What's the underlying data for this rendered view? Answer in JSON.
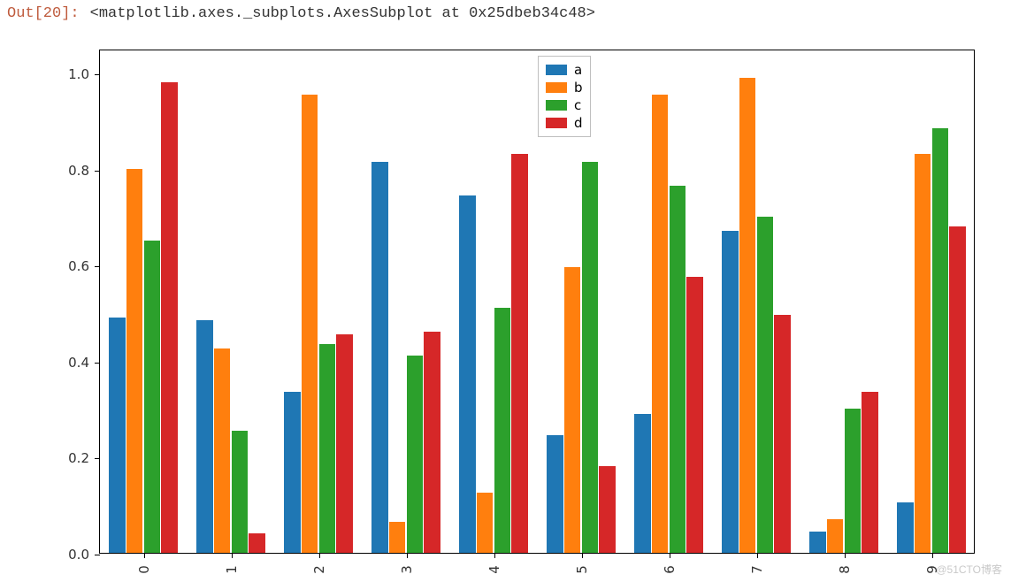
{
  "output_prompt": "Out[20]:",
  "output_repr": "<matplotlib.axes._subplots.AxesSubplot at 0x25dbeb34c48>",
  "watermark": "@51CTO博客",
  "chart_data": {
    "type": "bar",
    "title": "",
    "xlabel": "",
    "ylabel": "",
    "categories": [
      "0",
      "1",
      "2",
      "3",
      "4",
      "5",
      "6",
      "7",
      "8",
      "9"
    ],
    "series": [
      {
        "name": "a",
        "color": "#1f77b4",
        "values": [
          0.49,
          0.485,
          0.335,
          0.815,
          0.745,
          0.245,
          0.29,
          0.67,
          0.045,
          0.105
        ]
      },
      {
        "name": "b",
        "color": "#ff7f0e",
        "values": [
          0.8,
          0.425,
          0.955,
          0.065,
          0.125,
          0.595,
          0.955,
          0.99,
          0.07,
          0.83
        ]
      },
      {
        "name": "c",
        "color": "#2ca02c",
        "values": [
          0.65,
          0.255,
          0.435,
          0.41,
          0.51,
          0.815,
          0.765,
          0.7,
          0.3,
          0.885
        ]
      },
      {
        "name": "d",
        "color": "#d62728",
        "values": [
          0.98,
          0.04,
          0.455,
          0.46,
          0.83,
          0.18,
          0.575,
          0.495,
          0.335,
          0.68
        ]
      }
    ],
    "ylim": [
      0.0,
      1.05
    ],
    "yticks": [
      "0.0",
      "0.2",
      "0.4",
      "0.6",
      "0.8",
      "1.0"
    ],
    "legend_position": "top-center"
  }
}
